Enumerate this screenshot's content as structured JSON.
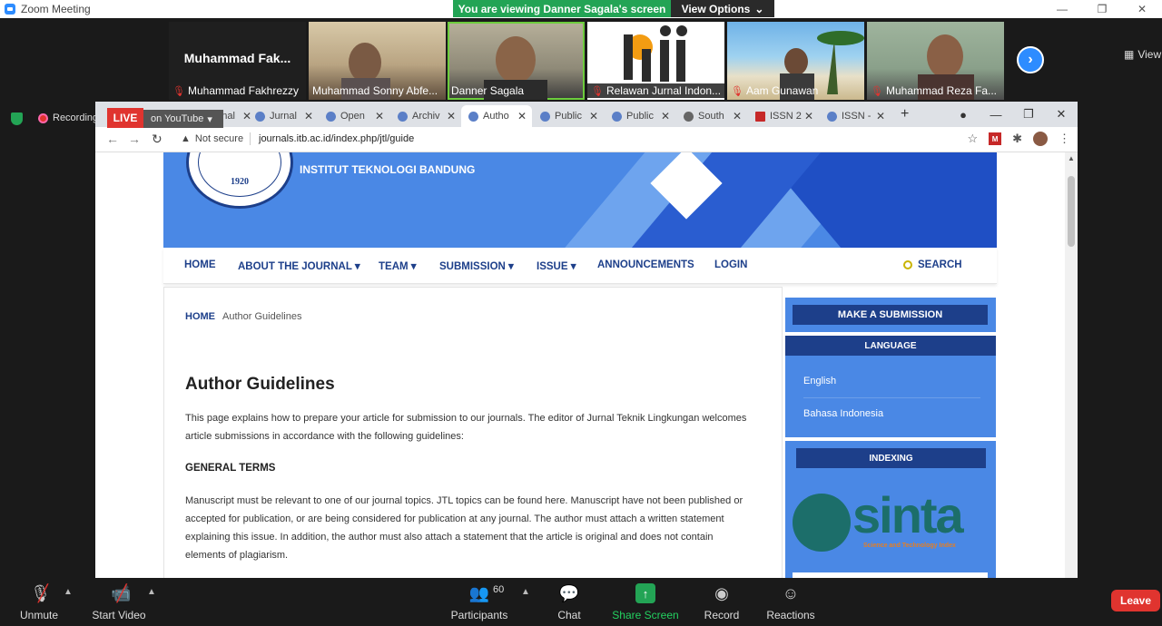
{
  "zoom": {
    "window_title": "Zoom Meeting",
    "viewing_banner": "You are viewing Danner Sagala's screen",
    "view_options": "View Options",
    "view_label": "View",
    "recording": "Recording",
    "live": "LIVE",
    "youtube": "on YouTube",
    "participants_count": "60",
    "toolbar": {
      "unmute": "Unmute",
      "start_video": "Start Video",
      "participants": "Participants",
      "chat": "Chat",
      "share_screen": "Share Screen",
      "record": "Record",
      "reactions": "Reactions",
      "leave": "Leave"
    },
    "tiles": [
      {
        "name": "Muhammad Fakhrezzy",
        "big": "Muhammad  Fak..."
      },
      {
        "name": "Muhammad Sonny Abfe..."
      },
      {
        "name": "Danner Sagala"
      },
      {
        "name": "Relawan Jurnal Indon..."
      },
      {
        "name": "Aam Gunawan"
      },
      {
        "name": "Muhammad Reza Fa..."
      }
    ]
  },
  "browser": {
    "tabs": [
      "Jurnal",
      "Jurnal",
      "Open",
      "Archiv",
      "Autho",
      "Public",
      "Public",
      "South",
      "ISSN 2",
      "ISSN -"
    ],
    "not_secure": "Not secure",
    "url": "journals.itb.ac.id/index.php/jtl/guide"
  },
  "site": {
    "institution": "INSTITUT TEKNOLOGI BANDUNG",
    "seal_year": "1920",
    "nav": [
      "HOME",
      "ABOUT THE JOURNAL",
      "TEAM",
      "SUBMISSION",
      "ISSUE",
      "ANNOUNCEMENTS",
      "LOGIN"
    ],
    "search": "SEARCH",
    "breadcrumb_home": "HOME",
    "breadcrumb_current": "Author Guidelines",
    "title": "Author Guidelines",
    "intro": "This page explains how to prepare your article for submission to our journals. The editor of Jurnal Teknik Lingkungan welcomes article submissions in accordance with the following guidelines:",
    "general_terms": "GENERAL TERMS",
    "general_text": "Manuscript must be relevant to one of our journal topics. JTL topics can be found here. Manuscript have not been published or accepted for publication, or are being considered for publication at any journal. The author must attach a written statement explaining this issue. In addition, the author must also attach a statement that the article is original and does not contain elements of plagiarism.",
    "make_submission": "MAKE A SUBMISSION",
    "language_head": "LANGUAGE",
    "languages": [
      "English",
      "Bahasa Indonesia"
    ],
    "indexing_head": "INDEXING",
    "sinta_word": "sinta",
    "sinta_sub": "Science and Technology Index"
  }
}
